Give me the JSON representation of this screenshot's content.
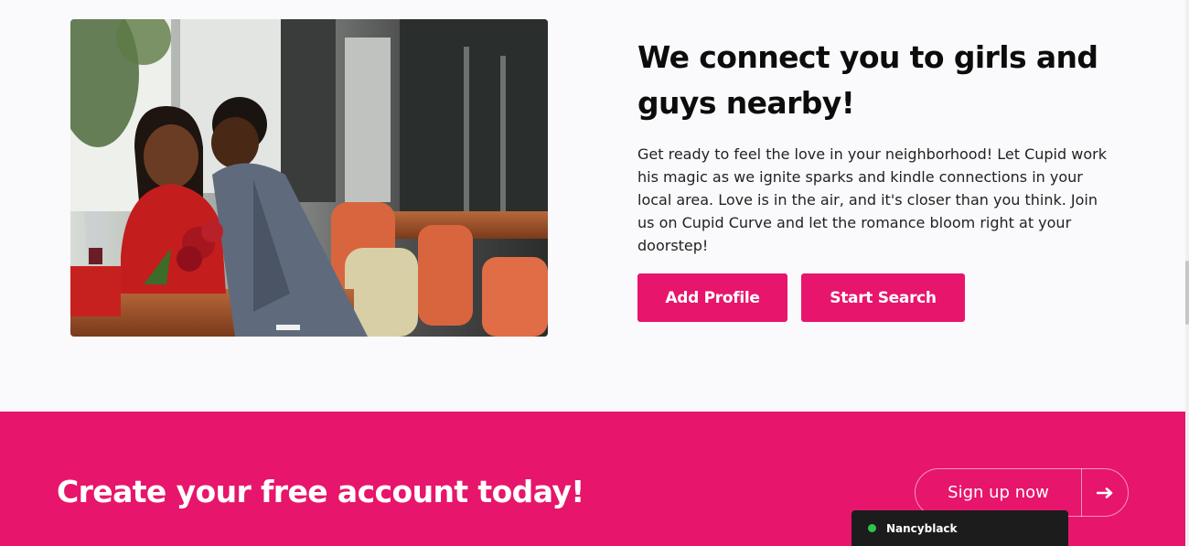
{
  "hero": {
    "headline_line1": "We connect you to girls and",
    "headline_line2": "guys nearby!",
    "body": "Get ready to feel the love in your neighborhood! Let Cupid work his magic as we ignite sparks and kindle connections in your local area. Love is in the air, and it's closer than you think. Join us on Cupid Curve and let the romance bloom right at your doorstep!",
    "add_profile_label": "Add Profile",
    "start_search_label": "Start Search"
  },
  "cta": {
    "title": "Create your free account today!",
    "signup_label": "Sign up now",
    "arrow_icon": "arrow-right-icon"
  },
  "chat": {
    "username": "Nancyblack",
    "status_color": "#2ec54a"
  },
  "colors": {
    "brand": "#e7156b",
    "page_bg": "#fafafc",
    "text": "#0c0c0c"
  }
}
